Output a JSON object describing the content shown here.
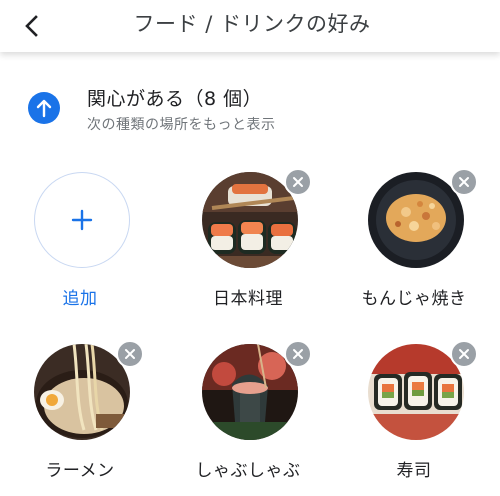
{
  "header": {
    "title": "フード / ドリンクの好み",
    "back_icon": "arrow-back-icon"
  },
  "section": {
    "title": "関心がある（8 個）",
    "subtitle": "次の種類の場所をもっと表示",
    "icon": "arrow-up-circle-icon",
    "accent_color": "#1a73e8"
  },
  "items": [
    {
      "label": "追加",
      "type": "add",
      "icon": "plus-icon"
    },
    {
      "label": "日本料理",
      "type": "food",
      "icon": "sushi-photo"
    },
    {
      "label": "もんじゃ焼き",
      "type": "food",
      "icon": "monjayaki-photo"
    },
    {
      "label": "ラーメン",
      "type": "food",
      "icon": "ramen-photo"
    },
    {
      "label": "しゃぶしゃぶ",
      "type": "food",
      "icon": "shabushabu-photo"
    },
    {
      "label": "寿司",
      "type": "food",
      "icon": "sushi-roll-photo"
    }
  ]
}
